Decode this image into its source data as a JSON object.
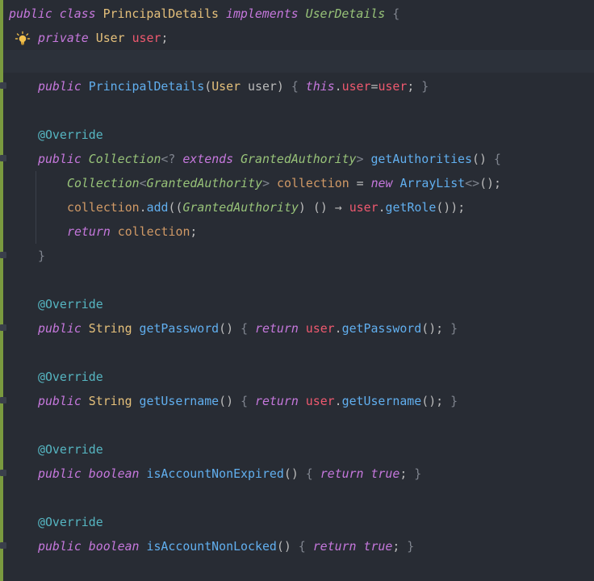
{
  "code_lines": [
    "public class PrincipalDetails implements UserDetails {",
    "private User user;",
    "",
    "public PrincipalDetails(User user) { this.user=user; }",
    "",
    "@Override",
    "public Collection<? extends GrantedAuthority> getAuthorities() {",
    "Collection<GrantedAuthority> collection = new ArrayList<>();",
    "collection.add((GrantedAuthority) () → user.getRole());",
    "return collection;",
    "}",
    "",
    "@Override",
    "public String getPassword() { return user.getPassword(); }",
    "",
    "@Override",
    "public String getUsername() { return user.getUsername(); }",
    "",
    "@Override",
    "public boolean isAccountNonExpired() { return true; }",
    "",
    "@Override",
    "public boolean isAccountNonLocked() { return true; }"
  ],
  "colors": {
    "background": "#282c34",
    "keyword": "#c678dd",
    "type": "#e5c07b",
    "field": "#ef596f",
    "method": "#61afef",
    "annotation": "#56b6c2",
    "change_marker": "#7a9a3f"
  },
  "icons": {
    "gutter_hint": "lightbulb-icon",
    "fold_marker": "fold-icon"
  }
}
